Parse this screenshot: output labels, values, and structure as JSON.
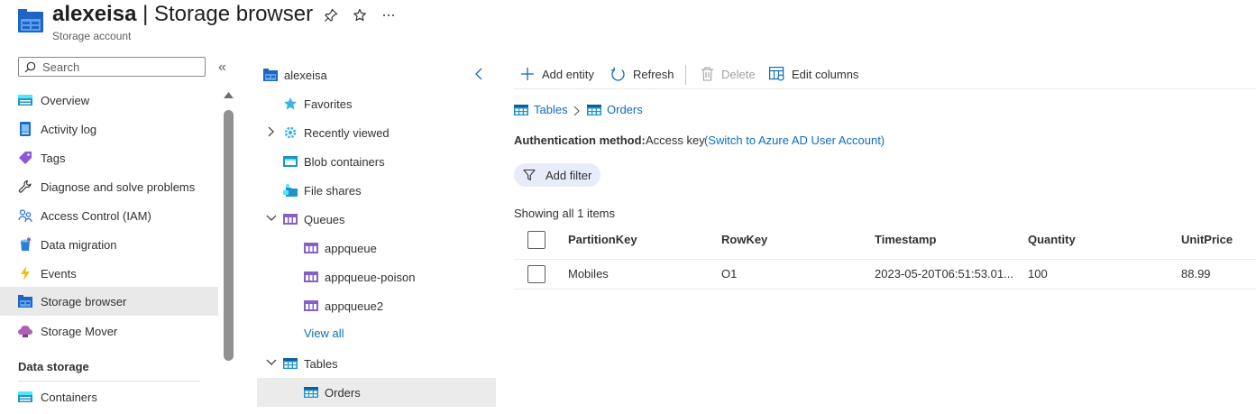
{
  "header": {
    "account": "alexeisa",
    "separator": " | ",
    "page": "Storage browser",
    "subtitle": "Storage account",
    "icons": [
      "storage-account-icon",
      "pin-icon",
      "star-icon",
      "more-icon"
    ]
  },
  "nav": {
    "search_placeholder": "Search",
    "collapse_glyph": "«",
    "items": [
      {
        "label": "Overview",
        "icon": "overview-icon"
      },
      {
        "label": "Activity log",
        "icon": "activity-log-icon"
      },
      {
        "label": "Tags",
        "icon": "tag-icon"
      },
      {
        "label": "Diagnose and solve problems",
        "icon": "wrench-icon"
      },
      {
        "label": "Access Control (IAM)",
        "icon": "people-icon"
      },
      {
        "label": "Data migration",
        "icon": "data-migration-icon"
      },
      {
        "label": "Events",
        "icon": "lightning-icon"
      },
      {
        "label": "Storage browser",
        "icon": "storage-browser-icon",
        "selected": true
      },
      {
        "label": "Storage Mover",
        "icon": "storage-mover-icon"
      }
    ],
    "section_data_storage": "Data storage",
    "section_items": [
      {
        "label": "Containers",
        "icon": "containers-icon"
      }
    ]
  },
  "tree": {
    "root": "alexeisa",
    "favorites": "Favorites",
    "recently_viewed": "Recently viewed",
    "blob_containers": "Blob containers",
    "file_shares": "File shares",
    "queues": "Queues",
    "queue_items": [
      "appqueue",
      "appqueue-poison",
      "appqueue2"
    ],
    "view_all": "View all",
    "tables": "Tables",
    "table_items": [
      "Orders"
    ]
  },
  "toolbar": {
    "add_entity": "Add entity",
    "refresh": "Refresh",
    "delete": "Delete",
    "edit_columns": "Edit columns"
  },
  "breadcrumb": {
    "tables": "Tables",
    "orders": "Orders"
  },
  "auth": {
    "label": "Authentication method:",
    "value": "Access key",
    "switch_link": "(Switch to Azure AD User Account)"
  },
  "filter": {
    "label": "Add filter"
  },
  "showing": "Showing all 1 items",
  "table": {
    "columns": [
      "PartitionKey",
      "RowKey",
      "Timestamp",
      "Quantity",
      "UnitPrice"
    ],
    "rows": [
      [
        "Mobiles",
        "O1",
        "2023-05-20T06:51:53.01...",
        "100",
        "88.99"
      ]
    ]
  },
  "colors": {
    "accent": "#0f6cbd",
    "selected_bg": "#e9e9e9",
    "filter_bg": "#e8ebfa"
  }
}
